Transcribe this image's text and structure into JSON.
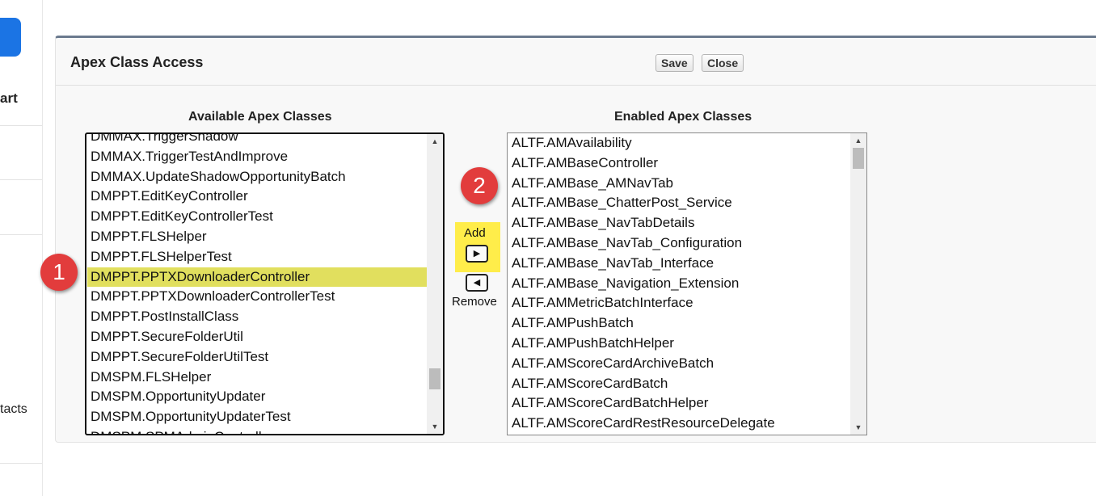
{
  "nav": {
    "partial_item_1": "art",
    "partial_item_2": "tacts"
  },
  "panel": {
    "title": "Apex Class Access",
    "save_label": "Save",
    "close_label": "Close"
  },
  "available": {
    "label": "Available Apex Classes",
    "options": [
      "DMMAX.TriggerShadow",
      "DMMAX.TriggerTestAndImprove",
      "DMMAX.UpdateShadowOpportunityBatch",
      "DMPPT.EditKeyController",
      "DMPPT.EditKeyControllerTest",
      "DMPPT.FLSHelper",
      "DMPPT.FLSHelperTest",
      "DMPPT.PPTXDownloaderController",
      "DMPPT.PPTXDownloaderControllerTest",
      "DMPPT.PostInstallClass",
      "DMPPT.SecureFolderUtil",
      "DMPPT.SecureFolderUtilTest",
      "DMSPM.FLSHelper",
      "DMSPM.OpportunityUpdater",
      "DMSPM.OpportunityUpdaterTest",
      "DMSPM.SPMAdminController"
    ],
    "selected": "DMPPT.PPTXDownloaderController",
    "scroll_position": 0.88
  },
  "enabled": {
    "label": "Enabled Apex Classes",
    "options": [
      "ALTF.AMAvailability",
      "ALTF.AMBaseController",
      "ALTF.AMBase_AMNavTab",
      "ALTF.AMBase_ChatterPost_Service",
      "ALTF.AMBase_NavTabDetails",
      "ALTF.AMBase_NavTab_Configuration",
      "ALTF.AMBase_NavTab_Interface",
      "ALTF.AMBase_Navigation_Extension",
      "ALTF.AMMetricBatchInterface",
      "ALTF.AMPushBatch",
      "ALTF.AMPushBatchHelper",
      "ALTF.AMScoreCardArchiveBatch",
      "ALTF.AMScoreCardBatch",
      "ALTF.AMScoreCardBatchHelper",
      "ALTF.AMScoreCardRestResourceDelegate"
    ],
    "scroll_position": 0.0
  },
  "controls": {
    "add_label": "Add",
    "remove_label": "Remove"
  },
  "callouts": {
    "first": "1",
    "second": "2"
  },
  "colors": {
    "selection_highlight": "#e1df5e",
    "add_highlight": "#ffed4a",
    "callout": "#e23c3c",
    "nav_button": "#1b74e4"
  },
  "icons": {
    "add_arrow": "triangle-right-icon",
    "remove_arrow": "triangle-left-icon",
    "scroll_up": "triangle-up-icon",
    "scroll_down": "triangle-down-icon"
  }
}
